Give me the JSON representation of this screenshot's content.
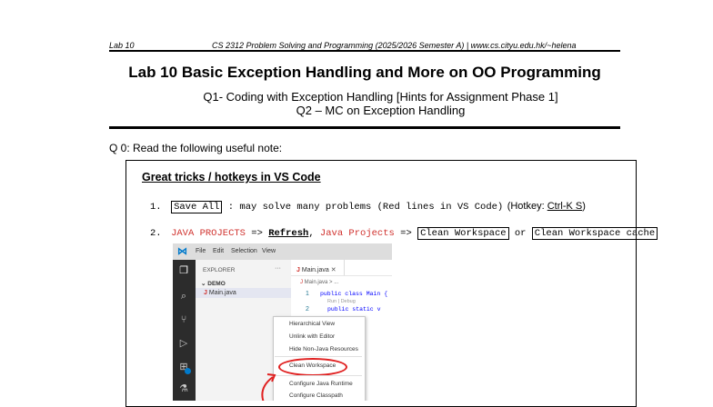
{
  "header": {
    "left": "Lab 10",
    "right": "CS 2312 Problem Solving and Programming (2025/2026 Semester A) | www.cs.cityu.edu.hk/~helena"
  },
  "title": "Lab 10 Basic Exception Handling and More on OO Programming",
  "subtitle1": "Q1- Coding with Exception Handling [Hints for Assignment Phase 1]",
  "subtitle2": "Q2 – MC on Exception Handling",
  "q0": "Q 0: Read the following useful note:",
  "note": {
    "heading": "Great tricks / hotkeys in VS Code",
    "item1": {
      "num": "1.",
      "save_all": "Save All",
      "text": " : may solve many problems (Red lines in VS Code)",
      "hotkey_prefix": "(Hotkey: ",
      "hotkey": "Ctrl-K S",
      "hotkey_suffix": ")"
    },
    "item2": {
      "num": "2.",
      "java_projects": "JAVA PROJECTS",
      "arrow1": " => ",
      "refresh": "Refresh",
      "comma": ", ",
      "java_projects2": "Java Projects",
      "arrow2": " => ",
      "clean_ws": "Clean Workspace",
      "or": " or ",
      "clean_ws_cache": "Clean Workspace cache"
    }
  },
  "vscode": {
    "menubar": [
      "File",
      "Edit",
      "Selection",
      "View"
    ],
    "explorer_label": "EXPLORER",
    "explorer_more": "···",
    "folder": "DEMO",
    "file": "Main.java",
    "tab": "Main.java",
    "breadcrumb": "Main.java > ...",
    "code": [
      {
        "n": "1",
        "text": "public class Main {"
      },
      {
        "n": "",
        "text": "Run | Debug"
      },
      {
        "n": "2",
        "text": "public static v"
      }
    ],
    "menu_items": [
      "Hierarchical View",
      "Unlink with Editor",
      "Hide Non-Java Resources",
      "Clean Workspace",
      "Configure Java Runtime",
      "Configure Classpath"
    ],
    "accent": "#007acc",
    "highlight": "#e02020"
  }
}
